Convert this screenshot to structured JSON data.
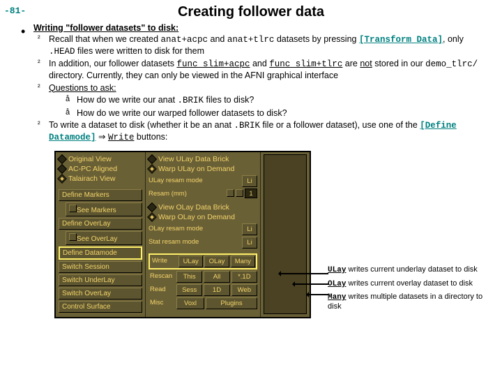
{
  "page_number": "-81-",
  "title": "Creating follower data",
  "section_heading": "Writing \"follower datasets\" to disk:",
  "bullets": {
    "b1a": "Recall that when we created ",
    "b1_code1": "anat+acpc",
    "b1_mid": " and ",
    "b1_code2": "anat+tlrc",
    "b1b": " datasets by pressing ",
    "b1_link": "[Transform Data]",
    "b1c": ", only ",
    "b1_code3": ".HEAD",
    "b1d": " files were written to disk for them",
    "b2a": "In addition, our follower datasets ",
    "b2_code1": "func_slim+acpc",
    "b2_mid": " and ",
    "b2_code2": "func_slim+tlrc",
    "b2b": " are ",
    "b2_not": "not",
    "b2c": " stored in our ",
    "b2_code3": "demo_tlrc/",
    "b2d": " directory.  Currently, they can only be viewed in the AFNI graphical interface",
    "b3": "Questions to ask:",
    "b3_q1a": "How do we write our anat ",
    "b3_q1b": ".BRIK",
    "b3_q1c": " files to disk?",
    "b3_q2": "How do we write our warped follower datasets to disk?",
    "b4a": "To write a dataset to disk (whether it be an anat ",
    "b4_code1": ".BRIK",
    "b4b": " file or a follower dataset), use one of the ",
    "b4_link": "[Define Datamode]",
    "b4_arrow": " ⇒ ",
    "b4_code2": "Write",
    "b4c": " buttons:"
  },
  "panel": {
    "col1": {
      "r1": "Original View",
      "r2": "AC-PC Aligned",
      "r3": "Talairach View",
      "b1": "Define Markers",
      "b2": "See Markers",
      "b3": "Define OverLay",
      "b4": "See OverLay",
      "b5": "Define Datamode",
      "b6": "Switch Session",
      "b7": "Switch UnderLay",
      "b8": "Switch OverLay",
      "b9": "Control Surface"
    },
    "col2": {
      "r1": "View ULay Data Brick",
      "r2": "Warp ULay on Demand",
      "lab1": "ULay resam mode",
      "val1": "Li",
      "lab2": "Resam (mm)",
      "val2": "1",
      "r3": "View OLay Data Brick",
      "r4": "Warp OLay on Demand",
      "lab3": "OLay resam mode",
      "val3": "Li",
      "lab4": "Stat resam mode",
      "val4": "Li",
      "row_write_lbl": "Write",
      "row_write_b1": "ULay",
      "row_write_b2": "OLay",
      "row_write_b3": "Many",
      "row_rescan_lbl": "Rescan",
      "row_rescan_b1": "This",
      "row_rescan_b2": "All",
      "row_rescan_b3": "*.1D",
      "row_read_lbl": "Read",
      "row_read_b1": "Sess",
      "row_read_b2": "1D",
      "row_read_b3": "Web",
      "row_misc_lbl": "Misc",
      "row_misc_b1": "Voxl",
      "row_misc_b2": "Plugins"
    }
  },
  "annotations": {
    "a1_code": "ULay",
    "a1_text": " writes current underlay dataset to disk",
    "a2_code": "OLay",
    "a2_text": " writes current overlay dataset to disk",
    "a3_code": "Many",
    "a3_text": " writes multiple datasets in a directory to disk"
  }
}
